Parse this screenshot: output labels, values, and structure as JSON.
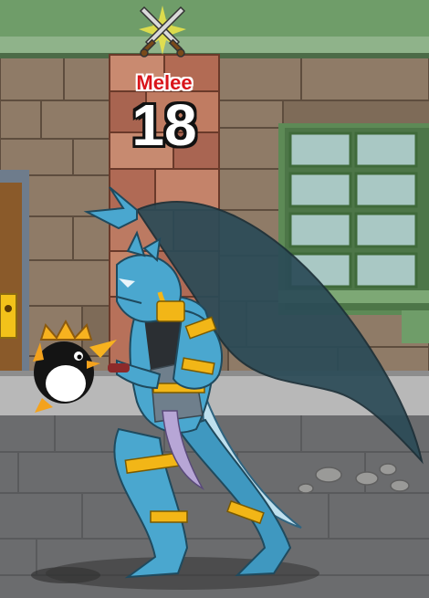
{
  "hud": {
    "attack_type": "Melee",
    "damage": "18",
    "icon": "crossed-swords-icon"
  },
  "colors": {
    "attack_label": "#d9151b",
    "damage_number": "#ffffff",
    "roof": "#8fb38a",
    "window_frame": "#5d8a56",
    "dragon_skin": "#4aa7cf",
    "dragon_wing": "#2b4b57",
    "armor_gold": "#f2b617"
  }
}
